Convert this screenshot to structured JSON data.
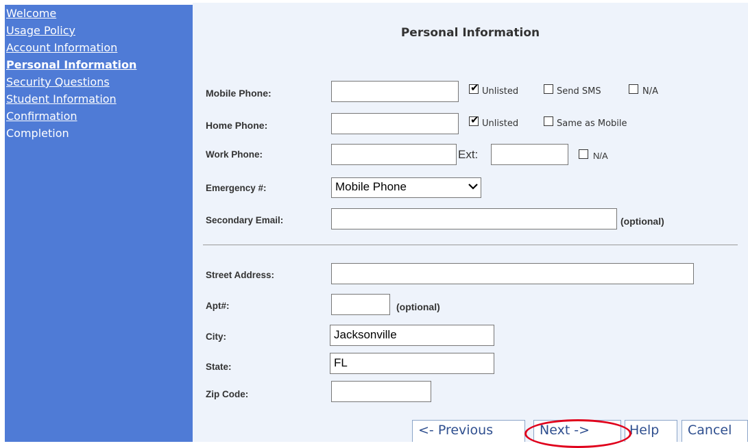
{
  "sidebar": {
    "items": [
      {
        "label": "Welcome"
      },
      {
        "label": "Usage Policy"
      },
      {
        "label": "Account Information"
      },
      {
        "label": "Personal Information"
      },
      {
        "label": "Security Questions"
      },
      {
        "label": "Student Information"
      },
      {
        "label": "Confirmation"
      },
      {
        "label": "Completion"
      }
    ]
  },
  "form": {
    "title": "Personal Information",
    "mobile_phone": {
      "label": "Mobile Phone:",
      "value": "",
      "unlisted": "Unlisted",
      "unlisted_checked": true,
      "send_sms": "Send SMS",
      "send_sms_checked": false,
      "na": "N/A",
      "na_checked": false
    },
    "home_phone": {
      "label": "Home Phone:",
      "value": "",
      "unlisted": "Unlisted",
      "unlisted_checked": true,
      "same_as_mobile": "Same as Mobile",
      "same_as_mobile_checked": false
    },
    "work_phone": {
      "label": "Work Phone:",
      "value": "",
      "ext_label": "Ext:",
      "ext_value": "",
      "na": "N/A",
      "na_checked": false
    },
    "emergency": {
      "label": "Emergency #:",
      "selected": "Mobile Phone"
    },
    "secondary_email": {
      "label": "Secondary Email:",
      "value": "",
      "optional": "(optional)"
    },
    "street_address": {
      "label": "Street Address:",
      "value": ""
    },
    "apt": {
      "label": "Apt#:",
      "value": "",
      "optional": "(optional)"
    },
    "city": {
      "label": "City:",
      "value": "Jacksonville"
    },
    "state": {
      "label": "State:",
      "value": "FL"
    },
    "zip": {
      "label": "Zip Code:",
      "value": ""
    }
  },
  "buttons": {
    "previous": "<- Previous",
    "next": "Next ->",
    "help": "Help",
    "cancel": "Cancel"
  },
  "colors": {
    "sidebar": "#4f7bd6",
    "main_bg": "#eef3fb",
    "highlight": "#e0001b"
  }
}
